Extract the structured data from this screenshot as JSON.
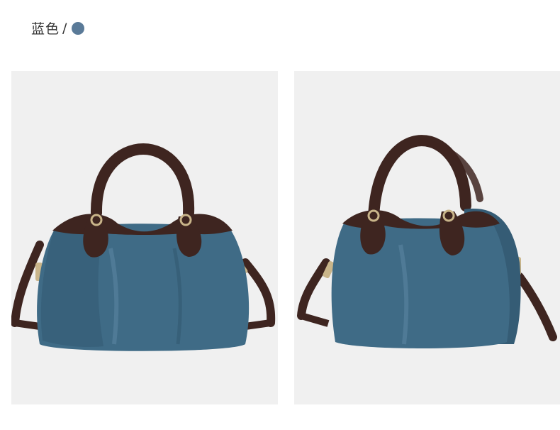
{
  "color_label": {
    "name": "蓝色",
    "separator": "/",
    "swatch_color": "#5a7a98"
  },
  "colors": {
    "bag_body": "#3f6b86",
    "bag_shadow": "#2c4f66",
    "bag_highlight": "#5f8aa6",
    "leather_trim": "#3e2520",
    "hardware": "#c9b58a"
  },
  "images": [
    {
      "view": "front"
    },
    {
      "view": "three-quarter"
    }
  ]
}
